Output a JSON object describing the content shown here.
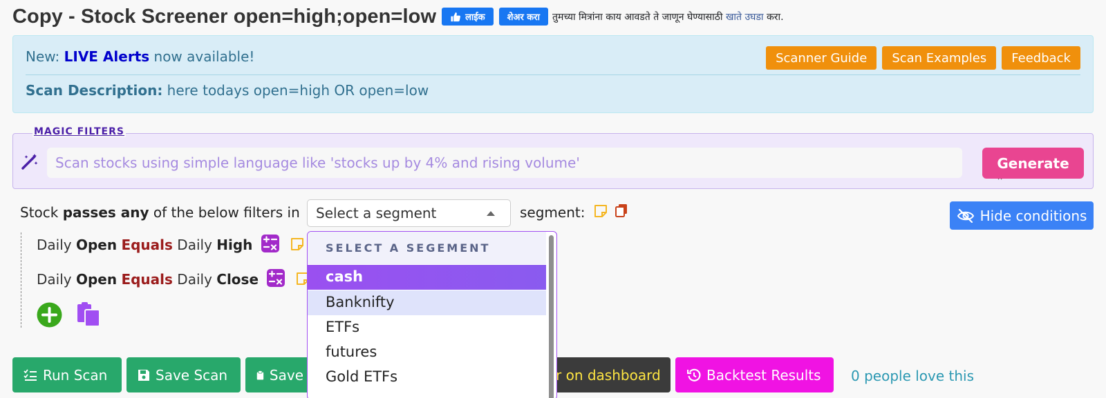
{
  "page": {
    "title": "Copy - Stock Screener open=high;open=low"
  },
  "facebook": {
    "like_label": "लाईक",
    "share_label": "शेअर करा",
    "prompt_before": "तुमच्या मित्रांना काय आवडते ते जाणून घेण्यासाठी",
    "prompt_link": "खाते उघडा",
    "prompt_after": "करा."
  },
  "alert": {
    "new_prefix": "New:",
    "live_alerts": "LIVE Alerts",
    "new_suffix": "now available!",
    "desc_label": "Scan Description:",
    "desc_text": "here todays open=high OR open=low",
    "buttons": [
      "Scanner Guide",
      "Scan Examples",
      "Feedback"
    ]
  },
  "magic": {
    "legend": "MAGIC FILTERS",
    "placeholder": "Scan stocks using simple language like 'stocks up by 4% and rising volume'",
    "generate_label": "Generate"
  },
  "filter_line": {
    "prefix": "Stock",
    "passes": "passes any",
    "suffix": "of the below filters in",
    "segment_value": "Select a segment",
    "segment_label": "segment:",
    "hide_label": "Hide conditions"
  },
  "conditions": [
    {
      "lhs_tf": "Daily",
      "lhs": "Open",
      "op": "Equals",
      "rhs_tf": "Daily",
      "rhs": "High"
    },
    {
      "lhs_tf": "Daily",
      "lhs": "Open",
      "op": "Equals",
      "rhs_tf": "Daily",
      "rhs": "Close"
    }
  ],
  "dropdown": {
    "header": "SELECT A SEGEMENT",
    "options": [
      "cash",
      "Banknifty",
      "ETFs",
      "futures",
      "Gold ETFs"
    ],
    "selected": "cash",
    "hovered": "Banknifty"
  },
  "bottom": {
    "run_scan": "Run Scan",
    "save_scan": "Save Scan",
    "save_partial": "Save",
    "dashboard_partial": "r on dashboard",
    "backtest": "Backtest Results",
    "love": "0 people love this"
  },
  "colors": {
    "orange": "#f0900c",
    "generate": "#e94591",
    "hide_button": "#3b82f6",
    "green_buttons": "#28a86b",
    "backtest": "#f013e3",
    "dropdown_selected": "#9a50f0"
  }
}
